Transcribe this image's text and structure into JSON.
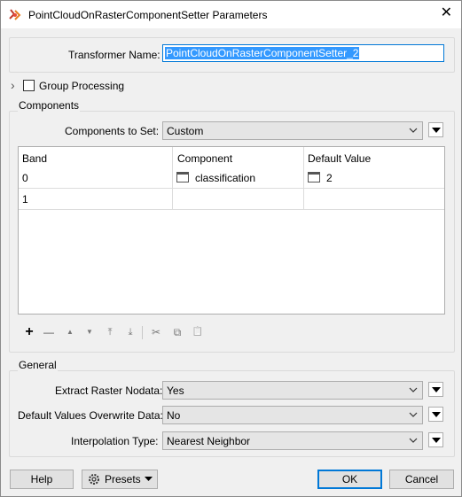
{
  "window": {
    "title": "PointCloudOnRasterComponentSetter Parameters",
    "close_glyph": "✕"
  },
  "transformer": {
    "label": "Transformer Name:",
    "value": "PointCloudOnRasterComponentSetter_2"
  },
  "group_processing": {
    "label": "Group Processing",
    "expand_glyph": "›",
    "checked": false
  },
  "components": {
    "section_label": "Components",
    "set_label": "Components to Set:",
    "set_value": "Custom",
    "table": {
      "columns": [
        "Band",
        "Component",
        "Default Value"
      ],
      "rows": [
        {
          "band": "0",
          "component": "classification",
          "default": "2"
        },
        {
          "band": "1",
          "component": "",
          "default": ""
        }
      ]
    },
    "toolbar": {
      "add": "+",
      "remove": "—",
      "up": "▲",
      "down": "▼",
      "top": "⤒",
      "bottom": "⤓",
      "cut": "✂",
      "copy": "⧉",
      "paste": "📋"
    }
  },
  "general": {
    "section_label": "General",
    "extract_label": "Extract Raster Nodata:",
    "extract_value": "Yes",
    "overwrite_label": "Default Values Overwrite Data:",
    "overwrite_value": "No",
    "interp_label": "Interpolation Type:",
    "interp_value": "Nearest Neighbor"
  },
  "footer": {
    "help": "Help",
    "presets": "Presets",
    "ok": "OK",
    "cancel": "Cancel"
  }
}
